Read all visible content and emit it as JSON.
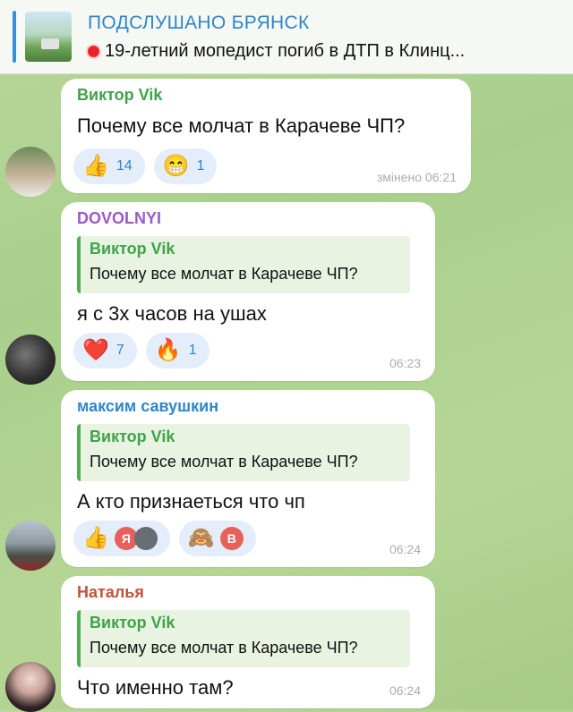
{
  "pinned": {
    "channel": "ПОДСЛУШАНО БРЯНСК",
    "text": "19-летний мопедист погиб в ДТП в Клинц..."
  },
  "messages": [
    {
      "sender": "Виктор Vik",
      "sender_color": "#3fa34a",
      "text": "Почему все молчат в Карачеве ЧП?",
      "reactions": [
        {
          "icon": "thumbs-up",
          "glyph": "👍",
          "count": "14"
        },
        {
          "icon": "grin",
          "glyph": "😁",
          "count": "1"
        }
      ],
      "time": "змінено 06:21"
    },
    {
      "sender": "DOVOLNYI",
      "sender_color": "#9b59c9",
      "reply": {
        "name": "Виктор Vik",
        "text": "Почему все молчат в Карачеве ЧП?"
      },
      "text": "я с 3х часов на ушах",
      "reactions": [
        {
          "icon": "heart",
          "glyph": "❤️",
          "count": "7"
        },
        {
          "icon": "fire",
          "glyph": "🔥",
          "count": "1"
        }
      ],
      "time": "06:23"
    },
    {
      "sender": "максим савушкин",
      "sender_color": "#2f86c8",
      "reply": {
        "name": "Виктор Vik",
        "text": "Почему все молчат в Карачеве ЧП?"
      },
      "text": "А кто признаеться  что чп",
      "reactions": [
        {
          "icon": "thumbs-up",
          "glyph": "👍",
          "avatars": [
            {
              "letter": "Я",
              "color": "#e8605a"
            },
            {
              "letter": "",
              "color": "#666d73"
            }
          ]
        },
        {
          "icon": "see-no-evil-monkey",
          "glyph": "🙈",
          "avatars": [
            {
              "letter": "В",
              "color": "#e8605a"
            }
          ]
        }
      ],
      "time": "06:24"
    },
    {
      "sender": "Наталья",
      "sender_color": "#c0533b",
      "reply": {
        "name": "Виктор Vik",
        "text": "Почему все молчат в Карачеве ЧП?"
      },
      "text": "Что именно там?",
      "time": "06:24"
    }
  ]
}
